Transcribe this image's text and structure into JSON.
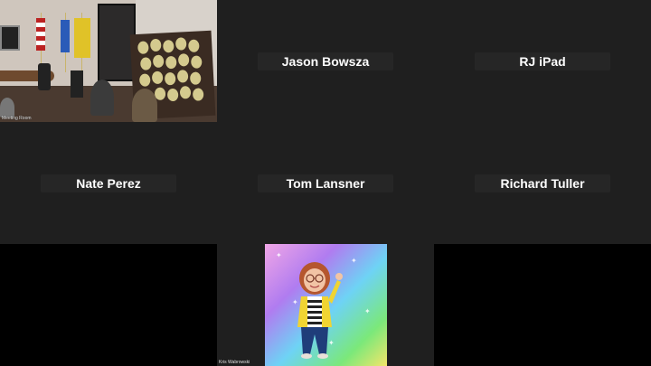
{
  "participants": {
    "meeting_room": {
      "label": "Meeting Room"
    },
    "jason": {
      "name": "Jason Bowsza"
    },
    "rj": {
      "name": "RJ iPad"
    },
    "nate": {
      "name": "Nate Perez"
    },
    "tom": {
      "name": "Tom Lansner"
    },
    "richard": {
      "name": "Richard Tuller"
    },
    "avatar_user": {
      "label": "Kris Wabrowski"
    }
  },
  "colors": {
    "tile_bg": "#1f1f1f",
    "name_plate_bg": "#262626",
    "name_text": "#ffffff"
  }
}
